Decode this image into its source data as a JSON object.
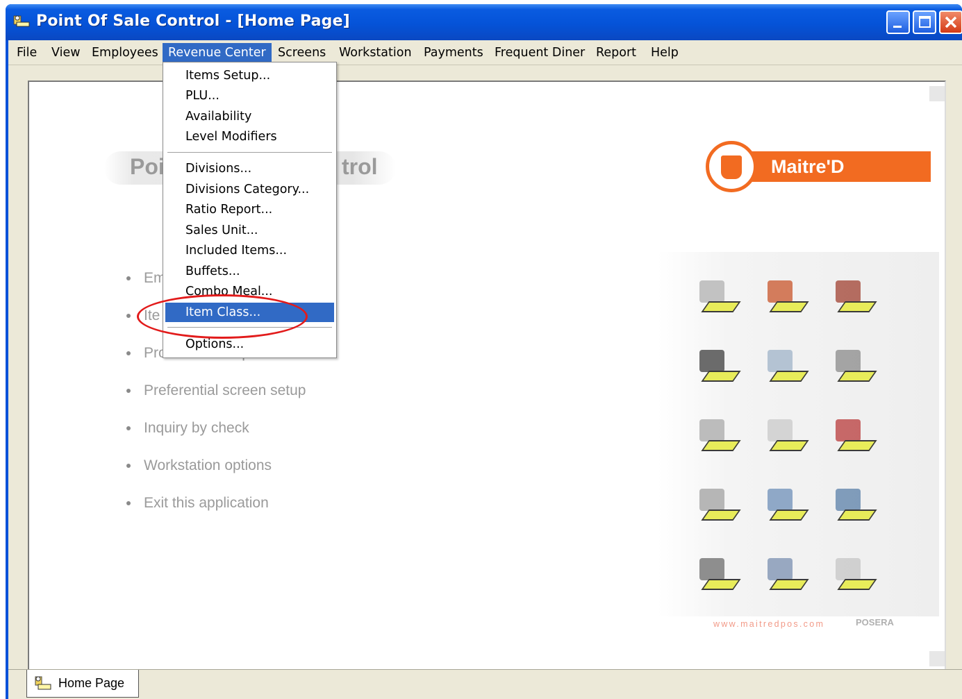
{
  "window": {
    "title": "Point Of Sale Control - [Home Page]",
    "controls": [
      "minimize",
      "maximize",
      "close"
    ]
  },
  "menubar": {
    "items": [
      {
        "label": "File"
      },
      {
        "label": "View"
      },
      {
        "label": "Employees"
      },
      {
        "label": "Revenue Center",
        "active": true
      },
      {
        "label": "Screens"
      },
      {
        "label": "Workstation"
      },
      {
        "label": "Payments"
      },
      {
        "label": "Frequent Diner"
      },
      {
        "label": "Report"
      },
      {
        "label": "Help"
      }
    ]
  },
  "dropdown": {
    "group1": [
      "Items Setup...",
      "PLU...",
      "Availability",
      "Level Modifiers"
    ],
    "group2": [
      "Divisions...",
      "Divisions Category...",
      "Ratio Report...",
      "Sales Unit...",
      "Included Items...",
      "Buffets...",
      "Combo Meal...",
      "Item Class..."
    ],
    "group3": [
      "Options..."
    ],
    "highlighted": "Item Class..."
  },
  "home": {
    "title": "Point Of Sale Control",
    "title_visible_left": "Poi",
    "title_visible_right": "trol",
    "brand": "Maitre'D",
    "items": [
      {
        "visible": "Em"
      },
      {
        "visible": "Ite"
      },
      {
        "visible": "Promotion setup"
      },
      {
        "visible": "Preferential screen setup"
      },
      {
        "visible": "Inquiry by check"
      },
      {
        "visible": "Workstation options"
      },
      {
        "visible": "Exit this application"
      }
    ],
    "website": "www.maitredpos.com",
    "pos_mark": "POSERA",
    "icons": [
      "user-settings-icon",
      "house-icon",
      "chef-icon",
      "keyboard-icon",
      "transfer-icon",
      "workstation-icon",
      "payments-icon",
      "receipt-roll-icon",
      "books-icon",
      "currency-icon",
      "chart-icon",
      "reports-icon",
      "network-icon",
      "printer-icon",
      "help-icon"
    ]
  },
  "tabs": [
    {
      "label": "Home Page"
    }
  ],
  "colors": {
    "titlebar": "#0553d8",
    "menu_highlight": "#316ac5",
    "brand_orange": "#f26b21",
    "annotation_red": "#e21b1b"
  }
}
